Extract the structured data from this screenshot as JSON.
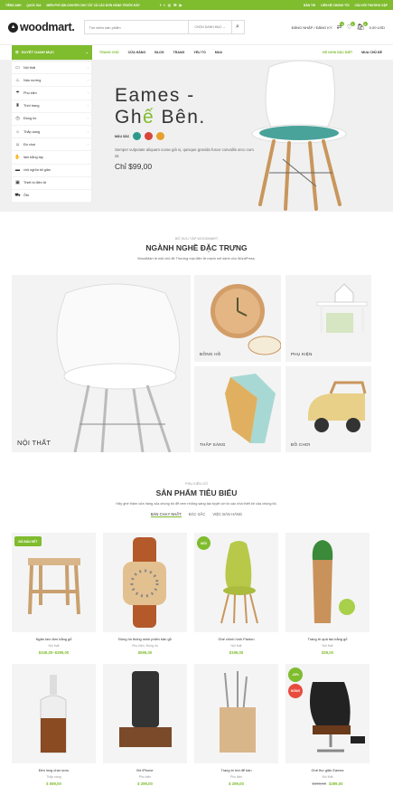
{
  "topbar": {
    "links": [
      "TIẾNG ANH",
      "QUỐC GIA",
      "MIỄN PHÍ VẬN CHUYỂN CHO TẤT CẢ CÁC ĐƠN HÀNG TRƯỚC ĐÂY"
    ],
    "social": [
      "f",
      "t",
      "◎",
      "✉",
      "▶"
    ],
    "right": [
      "BẢN TIN",
      "LIÊN HỆ CHÚNG TÔI",
      "CÂU HỎI THƯỜNG GẶP"
    ]
  },
  "header": {
    "logo": "woodmart.",
    "search_placeholder": "Tìm kiếm sản phẩm",
    "search_category": "CHỌN DANH MỤC",
    "login": "ĐĂNG NHẬP / ĐĂNG KÝ",
    "cart_count": "0",
    "wish_count": "0",
    "cart_total": "0,00 USD"
  },
  "nav": {
    "browse": "DUYỆT DANH MỤC",
    "items": [
      "TRANG CHỦ",
      "CỬA HÀNG",
      "BLOG",
      "TRANG",
      "YẾU TỐ",
      "MUA"
    ],
    "right": [
      "ĐỀ NGHỊ ĐẶC BIỆT",
      "MUA CHỦ ĐỀ"
    ]
  },
  "categories": [
    {
      "icon": "▭",
      "label": "Nội thất"
    },
    {
      "icon": "♨",
      "label": "Nấu nướng"
    },
    {
      "icon": "☂",
      "label": "Phụ kiện"
    },
    {
      "icon": "♜",
      "label": "Thời trang"
    },
    {
      "icon": "◷",
      "label": "Đồng hồ"
    },
    {
      "icon": "☼",
      "label": "Thắp sáng"
    },
    {
      "icon": "☺",
      "label": "Đồ chơi"
    },
    {
      "icon": "✋",
      "label": "làm bằng tay"
    },
    {
      "icon": "▬",
      "label": "chủ nghĩa tối giản"
    },
    {
      "icon": "▣",
      "label": "Thiết bị điện tử"
    },
    {
      "icon": "⛟",
      "label": "Ôtô"
    }
  ],
  "hero": {
    "title1": "Eames -",
    "title2_a": "Gh",
    "title2_b": "ế",
    "title2_c": " Bên.",
    "color_label": "MÀU SẮC",
    "colors": [
      "#2c9a8a",
      "#d9453b",
      "#e5a02e"
    ],
    "desc": "Semper vulputate aliquam curae giá vị, quisque gravida fusce convallis arcu cum sit.",
    "price": "Chỉ $99,00"
  },
  "categories_section": {
    "subtitle": "BỘ SƯU TẬP WOODMART",
    "title": "NGÀNH NGHỀ ĐẶC TRƯNG",
    "desc": "WoodMart là một chủ đề Thương mại điện tử mạnh mẽ dành cho WordPress.",
    "tiles": [
      "NỘI THẤT",
      "ĐỒNG HỒ",
      "PHỤ KIỆN",
      "THẮP SÁNG",
      "ĐỒ CHƠI"
    ]
  },
  "products_section": {
    "subtitle": "PHỤ KIỆN GỖ",
    "title": "SẢN PHẨM TIÊU BIỂU",
    "desc": "Hãy ghé thăm cửa hàng của chúng tôi để xem những sáng tạo tuyệt vời từ các nhà thiết kế của chúng tôi.",
    "tabs": [
      "BÁN CHẠY NHẤT",
      "ĐẶC SẮC",
      "VIỆC BÁN HÀNG"
    ],
    "products": [
      {
        "name": "Ngăn kéo đơn bằng gỗ",
        "cat": "Nội thất",
        "price": "$349,00–$399,00",
        "old": "",
        "tag": "ĐÃ BÁN HẾT",
        "tag_color": "#7fbc2e"
      },
      {
        "name": "Đồng hồ thông minh phiên bản gỗ",
        "cat": "Phụ kiện, Đồng hồ",
        "price": "$599,00",
        "old": "",
        "tag": "",
        "tag_color": ""
      },
      {
        "name": "Ghế chính hình Panton",
        "cat": "Nội thất",
        "price": "$199,00",
        "old": "",
        "tag": "MỚI",
        "tag_color": "#7fbc2e"
      },
      {
        "name": "Trang trí quả táo bằng gỗ",
        "cat": "Nội thất",
        "price": "$39,00",
        "old": "",
        "tag": "",
        "tag_color": ""
      },
      {
        "name": "Đèn lồng chai rượu",
        "cat": "Thắp sáng",
        "price": "$ 599,00",
        "old": "",
        "tag": "",
        "tag_color": ""
      },
      {
        "name": "Đế iPhone",
        "cat": "Phụ kiện",
        "price": "$ 299,00",
        "old": "",
        "tag": "",
        "tag_color": ""
      },
      {
        "name": "Trang trí bút để bàn",
        "cat": "Phụ kiện",
        "price": "$ 299,00",
        "old": "",
        "tag": "",
        "tag_color": ""
      },
      {
        "name": "Ghế thư giãn Eames",
        "cat": "Nội thất",
        "price": "$399,00",
        "old": "$499,00",
        "tag": "-20%",
        "tag_color": "#7fbc2e",
        "tag2": "NÓNG",
        "tag2_color": "#e84c3d"
      }
    ]
  }
}
